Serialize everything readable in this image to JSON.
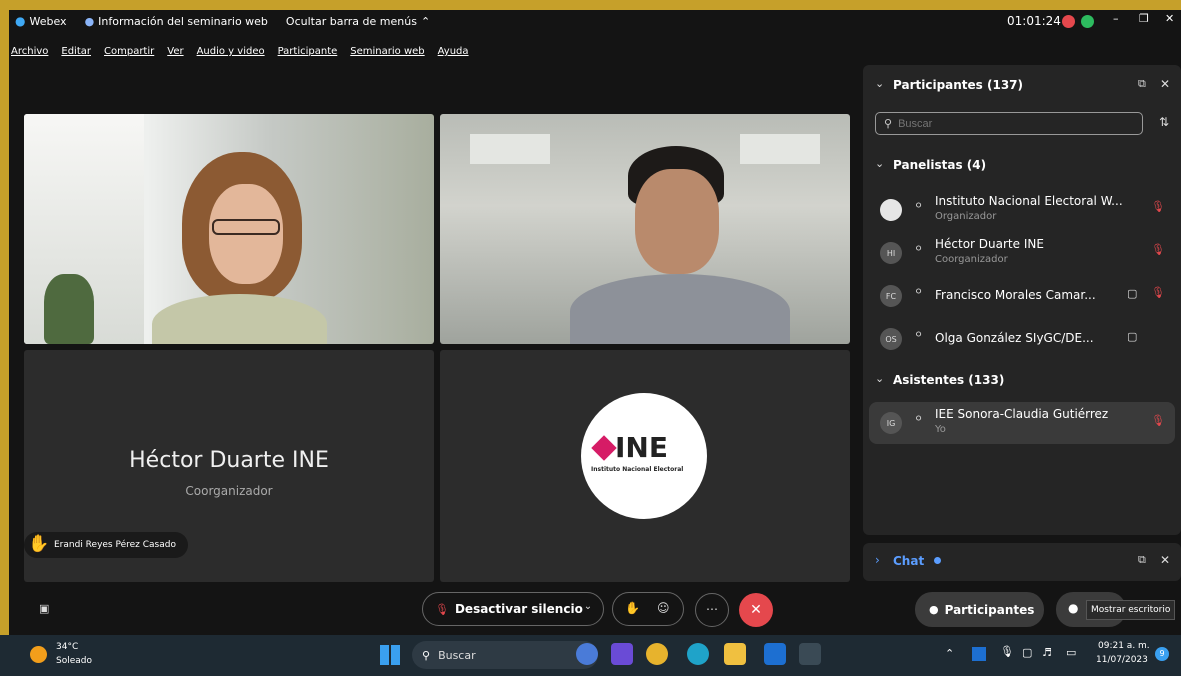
{
  "titlebar": {
    "app": "Webex",
    "info": "Información del seminario web",
    "hide_menu": "Ocultar barra de menús",
    "timer": "01:01:24"
  },
  "menu": [
    "Archivo",
    "Editar",
    "Compartir",
    "Ver",
    "Audio y video",
    "Participante",
    "Seminario web",
    "Ayuda"
  ],
  "video": {
    "name": "Héctor Duarte INE",
    "role": "Coorganizador",
    "hand_name": "Erandi Reyes Pérez Casado",
    "ine_text": "INE",
    "ine_sub": "Instituto Nacional Electoral"
  },
  "panel": {
    "title": "Participantes (137)",
    "search_placeholder": "Buscar",
    "panelists_header": "Panelistas (4)",
    "attendees_header": "Asistentes (133)",
    "chat_label": "Chat"
  },
  "panelists": [
    {
      "initials": "",
      "name": "Instituto Nacional Electoral W...",
      "role": "Organizador"
    },
    {
      "initials": "HI",
      "name": "Héctor Duarte INE",
      "role": "Coorganizador"
    },
    {
      "initials": "FC",
      "name": "Francisco Morales Camar...",
      "role": ""
    },
    {
      "initials": "OS",
      "name": "Olga González SIyGC/DE...",
      "role": ""
    }
  ],
  "attendee": {
    "initials": "IG",
    "name": "IEE Sonora-Claudia Gutiérrez",
    "role": "Yo"
  },
  "controls": {
    "unmute": "Desactivar silencio",
    "participants": "Participantes",
    "show_desktop": "Mostrar escritorio"
  },
  "taskbar": {
    "temp": "34°C",
    "weather": "Soleado",
    "search": "Buscar",
    "time": "09:21 a. m.",
    "date": "11/07/2023",
    "badge": "9"
  }
}
